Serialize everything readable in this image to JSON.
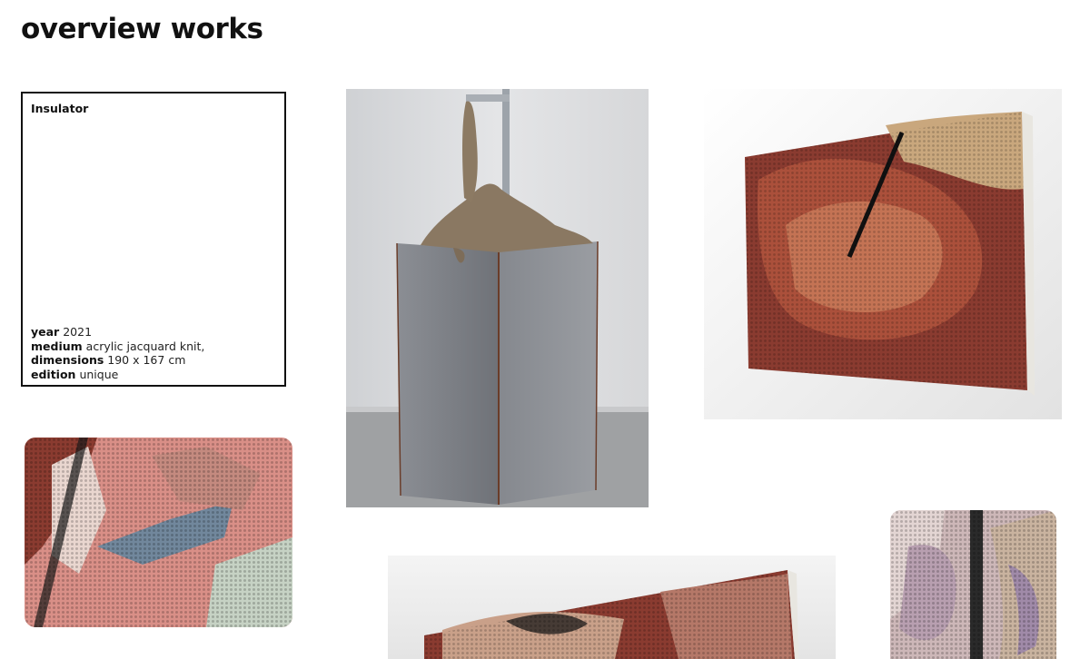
{
  "page": {
    "title": "overview works"
  },
  "work": {
    "title": "Insulator",
    "details": [
      {
        "label": "year",
        "value": "2021"
      },
      {
        "label": "medium",
        "value": "acrylic jacquard knit,"
      },
      {
        "label": "dimensions",
        "value": "190 x 167 cm"
      },
      {
        "label": "edition",
        "value": "unique"
      }
    ]
  },
  "colors": {
    "text": "#111111",
    "border": "#111111",
    "gallery_wall": "#dcdcdc",
    "steel": "#7d8087",
    "knit_red": "#8a3b30",
    "knit_pink": "#d98f87"
  }
}
